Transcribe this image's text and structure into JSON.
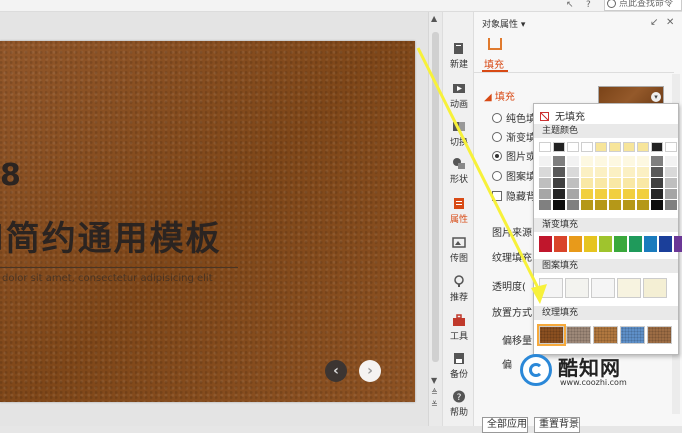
{
  "topbar": {
    "search_placeholder": "点此查找命令",
    "icons": [
      "cursor-icon",
      "help-icon",
      "search-icon"
    ]
  },
  "slide": {
    "number": "8",
    "title": "l简约通用模板",
    "subtitle": "dolor sit amet, consectetur adipisicing elit",
    "prev_label": "‹",
    "next_label": "›",
    "background_color": "#8a4f20"
  },
  "toolstrip": {
    "items": [
      {
        "label": "新建",
        "icon": "new-icon"
      },
      {
        "label": "动画",
        "icon": "animation-icon"
      },
      {
        "label": "切换",
        "icon": "transition-icon"
      },
      {
        "label": "形状",
        "icon": "shape-icon"
      },
      {
        "label": "属性",
        "icon": "property-icon",
        "active": true
      },
      {
        "label": "传图",
        "icon": "upload-image-icon"
      },
      {
        "label": "推荐",
        "icon": "recommend-icon"
      },
      {
        "label": "工具",
        "icon": "tools-icon"
      },
      {
        "label": "备份",
        "icon": "backup-icon"
      },
      {
        "label": "帮助",
        "icon": "help-icon"
      }
    ]
  },
  "panel": {
    "title": "对象属性 ▾",
    "tab": "填充",
    "section": "◢ 填充",
    "fill_options": [
      {
        "label": "纯色填",
        "selected": false
      },
      {
        "label": "渐变填",
        "selected": false
      },
      {
        "label": "图片或",
        "selected": true
      },
      {
        "label": "图案填",
        "selected": false
      }
    ],
    "hide_bg_label": "隐藏背",
    "picture_source": "图片来源",
    "texture_fill": "纹理填充",
    "transparency": "透明度(",
    "placement": "放置方式",
    "offset": "偏移量",
    "offset2": "偏",
    "apply_all": "全部应用",
    "reset_bg": "重置背景",
    "accent_color": "#d84a15"
  },
  "popup": {
    "no_fill": "无填充",
    "theme_colors": "主题颜色",
    "gradient_fill": "渐变填充",
    "pattern_fill": "图案填充",
    "texture_fill": "纹理填充",
    "theme_top_row": [
      "#ffffff",
      "#222222",
      "#ffffff",
      "#ffffff",
      "#f7e59a",
      "#f7e59a",
      "#f7e59a",
      "#f7e59a",
      "#222222",
      "#ffffff"
    ],
    "theme_shade_columns": [
      [
        "#f2f2f2",
        "#d9d9d9",
        "#bfbfbf",
        "#a6a6a6",
        "#808080"
      ],
      [
        "#7f7f7f",
        "#595959",
        "#404040",
        "#262626",
        "#0d0d0d"
      ],
      [
        "#f2f2f2",
        "#d9d9d9",
        "#bfbfbf",
        "#a6a6a6",
        "#808080"
      ],
      [
        "#fdf8e1",
        "#fbf0c3",
        "#f9e8a5",
        "#f1cf3f",
        "#b59818"
      ],
      [
        "#fdf8e1",
        "#fbf0c3",
        "#f9e8a5",
        "#f1cf3f",
        "#b59818"
      ],
      [
        "#fdf8e1",
        "#fbf0c3",
        "#f9e8a5",
        "#f1cf3f",
        "#b59818"
      ],
      [
        "#fdf8e1",
        "#fbf0c3",
        "#f9e8a5",
        "#f1cf3f",
        "#b59818"
      ],
      [
        "#fdf8e1",
        "#fbf0c3",
        "#f9e8a5",
        "#f1cf3f",
        "#b59818"
      ],
      [
        "#7f7f7f",
        "#595959",
        "#404040",
        "#262626",
        "#0d0d0d"
      ],
      [
        "#f2f2f2",
        "#d9d9d9",
        "#bfbfbf",
        "#a6a6a6",
        "#808080"
      ]
    ],
    "gradients": [
      "#c0162c",
      "#d9442a",
      "#e89a1a",
      "#e6c420",
      "#9fc42d",
      "#3aa83c",
      "#1f9a5b",
      "#1a7bbd",
      "#1b3f9a",
      "#6b3796"
    ],
    "patterns": [
      "#f4f4f4",
      "#f3f3ef",
      "#f5f5f5",
      "#f7f3e0",
      "#f4efd4"
    ],
    "textures": [
      "#8a4f20",
      "#9d8878",
      "#b0773f",
      "#5e8fc7",
      "#9c6c44"
    ]
  },
  "watermark": {
    "name": "酷知网",
    "url": "www.coozhi.com"
  },
  "annotation_color": "#f7f13a"
}
